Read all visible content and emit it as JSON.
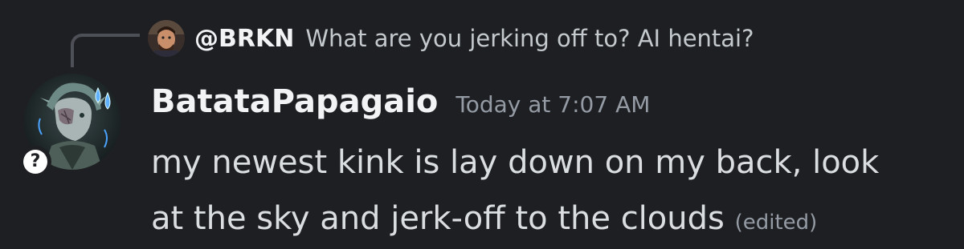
{
  "reply": {
    "author": "@BRKN",
    "text": "What are you jerking off to? AI hentai?"
  },
  "message": {
    "author": "BatataPapagaio",
    "timestamp": "Today at 7:07 AM",
    "line1": "my newest kink is lay down on my back, look",
    "line2": "at the sky and jerk-off to the clouds",
    "edited_label": "(edited)"
  },
  "badge": {
    "glyph": "?"
  },
  "colors": {
    "background": "#1e1f22",
    "author": "#f2f3f5",
    "body": "#dbdee1",
    "muted": "#949ba4",
    "spine": "#4e5058"
  }
}
